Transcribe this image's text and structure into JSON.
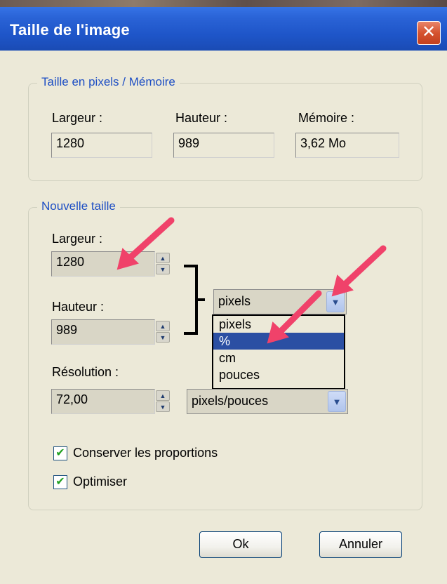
{
  "window": {
    "title": "Taille de l'image",
    "close_glyph": "✕"
  },
  "group_memory": {
    "title": "Taille en pixels / Mémoire",
    "width_label": "Largeur :",
    "width_value": "1280",
    "height_label": "Hauteur :",
    "height_value": "989",
    "memory_label": "Mémoire :",
    "memory_value": "3,62 Mo"
  },
  "group_new_size": {
    "title": "Nouvelle taille",
    "width_label": "Largeur :",
    "width_value": "1280",
    "height_label": "Hauteur :",
    "height_value": "989",
    "resolution_label": "Résolution :",
    "resolution_value": "72,00",
    "unit_select_value": "pixels",
    "unit_options": [
      "pixels",
      "%",
      "cm",
      "pouces"
    ],
    "unit_selected_index": 1,
    "resolution_unit_value": "pixels/pouces"
  },
  "options": {
    "keep_proportions_label": "Conserver les proportions",
    "keep_proportions_checked": true,
    "optimize_label": "Optimiser",
    "optimize_checked": true
  },
  "buttons": {
    "ok": "Ok",
    "cancel": "Annuler"
  },
  "icons": [
    "close-icon",
    "spin-up-icon",
    "spin-down-icon",
    "chevron-down-icon",
    "checkmark-icon",
    "red-arrow-annotation"
  ],
  "colors": {
    "titlebar": "#2a63d6",
    "group_title": "#1e4fc4",
    "selection": "#2b4fa3",
    "annotation_arrow": "#f0426a",
    "check": "#21a121"
  }
}
